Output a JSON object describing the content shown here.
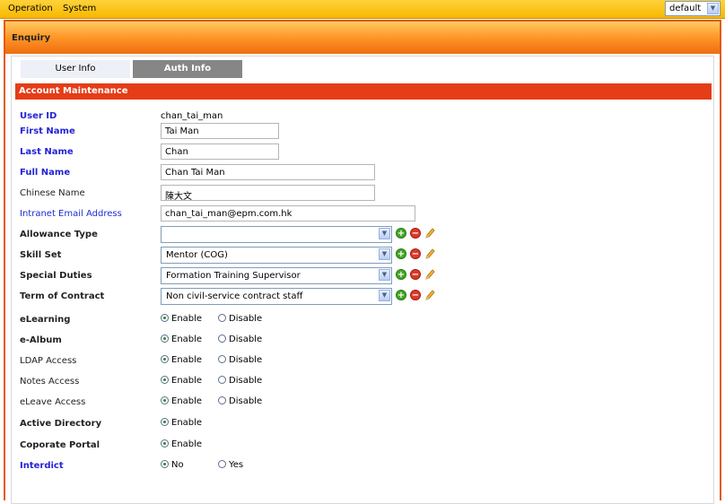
{
  "menu": {
    "items": [
      "Operation",
      "System"
    ],
    "theme_value": "default"
  },
  "panel": {
    "title": "Enquiry"
  },
  "tabs": {
    "user_info": "User Info",
    "auth_info": "Auth Info"
  },
  "section": {
    "title": "Account Maintenance"
  },
  "fields": {
    "user_id": {
      "label": "User ID",
      "value": "chan_tai_man"
    },
    "first_name": {
      "label": "First Name",
      "value": "Tai Man"
    },
    "last_name": {
      "label": "Last Name",
      "value": "Chan"
    },
    "full_name": {
      "label": "Full Name",
      "value": "Chan Tai Man"
    },
    "chinese_name": {
      "label": "Chinese Name",
      "value": "陳大文"
    },
    "email": {
      "label": "Intranet Email Address",
      "value": "chan_tai_man@epm.com.hk"
    },
    "allowance_type": {
      "label": "Allowance Type",
      "value": ""
    },
    "skill_set": {
      "label": "Skill Set",
      "value": "Mentor (COG)"
    },
    "special_duties": {
      "label": "Special Duties",
      "value": "Formation Training Supervisor"
    },
    "term_of_contract": {
      "label": "Term of Contract",
      "value": "Non civil-service contract staff"
    }
  },
  "radios": {
    "enable": "Enable",
    "disable": "Disable",
    "no": "No",
    "yes": "Yes",
    "elearning": "eLearning",
    "ealbum": "e-Album",
    "ldap": "LDAP Access",
    "notes": "Notes Access",
    "eleave": "eLeave Access",
    "active_directory": "Active Directory",
    "corporate_portal": "Coporate Portal",
    "interdict": "Interdict"
  },
  "icons": {
    "add": "add-circle-icon",
    "remove": "remove-circle-icon",
    "edit": "pencil-icon",
    "dropdown": "chevron-down-icon"
  },
  "colors": {
    "menu_bar": "#f7b800",
    "header": "#ef6d10",
    "section": "#e43d18",
    "required_label": "#2424d8"
  }
}
